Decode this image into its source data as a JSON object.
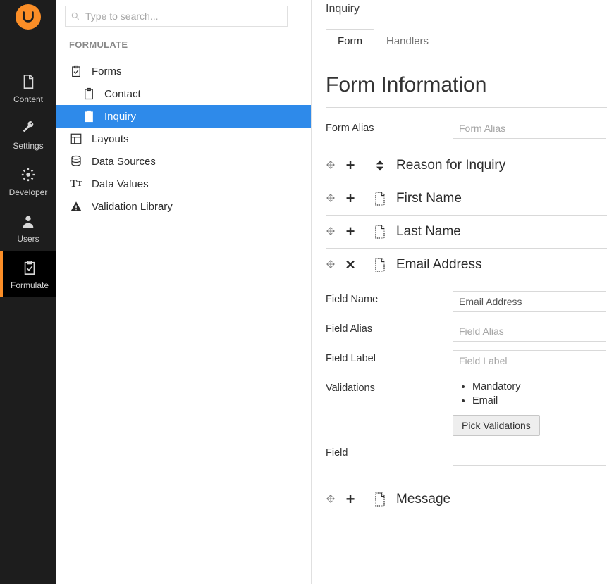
{
  "nav": {
    "items": [
      {
        "key": "content",
        "label": "Content"
      },
      {
        "key": "settings",
        "label": "Settings"
      },
      {
        "key": "developer",
        "label": "Developer"
      },
      {
        "key": "users",
        "label": "Users"
      },
      {
        "key": "formulate",
        "label": "Formulate"
      }
    ],
    "active": "formulate"
  },
  "search": {
    "placeholder": "Type to search..."
  },
  "tree": {
    "header": "FORMULATE",
    "items": [
      {
        "label": "Forms",
        "icon": "clipboard-check",
        "children": [
          {
            "label": "Contact",
            "icon": "clipboard"
          },
          {
            "label": "Inquiry",
            "icon": "clipboard",
            "active": true
          }
        ]
      },
      {
        "label": "Layouts",
        "icon": "layout"
      },
      {
        "label": "Data Sources",
        "icon": "database"
      },
      {
        "label": "Data Values",
        "icon": "tt"
      },
      {
        "label": "Validation Library",
        "icon": "warn"
      }
    ]
  },
  "main": {
    "breadcrumb": "Inquiry",
    "tabs": [
      {
        "label": "Form",
        "active": true
      },
      {
        "label": "Handlers"
      }
    ],
    "heading": "Form Information",
    "alias_label": "Form Alias",
    "alias_placeholder": "Form Alias",
    "fields": [
      {
        "title": "Reason for Inquiry",
        "type_icon": "select",
        "expanded": false,
        "toggle": "plus"
      },
      {
        "title": "First Name",
        "type_icon": "text",
        "expanded": false,
        "toggle": "plus"
      },
      {
        "title": "Last Name",
        "type_icon": "text",
        "expanded": false,
        "toggle": "plus"
      },
      {
        "title": "Email Address",
        "type_icon": "text",
        "expanded": true,
        "toggle": "x",
        "detail": {
          "field_name_label": "Field Name",
          "field_name_value": "Email Address",
          "field_alias_label": "Field Alias",
          "field_alias_placeholder": "Field Alias",
          "field_label_label": "Field Label",
          "field_label_placeholder": "Field Label",
          "validations_label": "Validations",
          "validations": [
            "Mandatory",
            "Email"
          ],
          "pick_button": "Pick Validations",
          "field_label2": "Field"
        }
      },
      {
        "title": "Message",
        "type_icon": "text",
        "expanded": false,
        "toggle": "plus"
      }
    ]
  }
}
